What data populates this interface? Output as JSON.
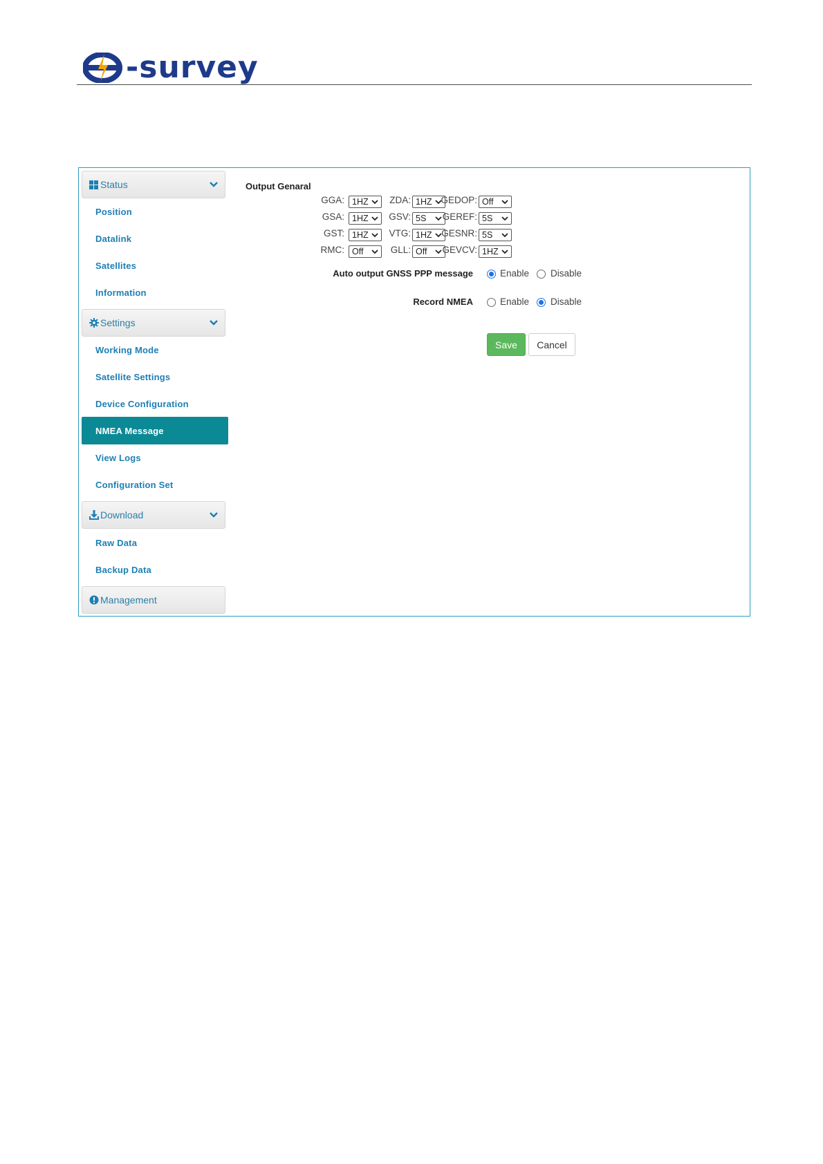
{
  "brand": {
    "name": "-survey",
    "color": "#1e3a8a"
  },
  "sidebar": {
    "groups": [
      {
        "label": "Status",
        "icon": "grid-icon"
      },
      {
        "label": "Settings",
        "icon": "gear-icon"
      },
      {
        "label": "Download",
        "icon": "download-icon"
      },
      {
        "label": "Management",
        "icon": "info-circle-icon"
      }
    ],
    "status_items": [
      "Position",
      "Datalink",
      "Satellites",
      "Information"
    ],
    "settings_items": [
      "Working Mode",
      "Satellite Settings",
      "Device Configuration",
      "NMEA Message",
      "View Logs",
      "Configuration Set"
    ],
    "download_items": [
      "Raw Data",
      "Backup Data"
    ],
    "active_item": "NMEA Message",
    "active_color": "#0b8a96",
    "link_color": "#1d7fb5"
  },
  "main": {
    "section_title": "Output Genaral",
    "nmea": [
      {
        "label": "GGA:",
        "value": "1HZ"
      },
      {
        "label": "ZDA:",
        "value": "1HZ"
      },
      {
        "label": "GEDOP:",
        "value": "Off"
      },
      {
        "label": "GSA:",
        "value": "1HZ"
      },
      {
        "label": "GSV:",
        "value": "5S"
      },
      {
        "label": "GEREF:",
        "value": "5S"
      },
      {
        "label": "GST:",
        "value": "1HZ"
      },
      {
        "label": "VTG:",
        "value": "1HZ"
      },
      {
        "label": "GESNR:",
        "value": "5S"
      },
      {
        "label": "RMC:",
        "value": "Off"
      },
      {
        "label": "GLL:",
        "value": "Off"
      },
      {
        "label": "GEVCV:",
        "value": "1HZ"
      }
    ],
    "auto_output": {
      "label": "Auto output GNSS PPP message",
      "enable": "Enable",
      "disable": "Disable",
      "selected": "Enable"
    },
    "record_nmea": {
      "label": "Record NMEA",
      "enable": "Enable",
      "disable": "Disable",
      "selected": "Disable"
    },
    "save_label": "Save",
    "cancel_label": "Cancel"
  }
}
